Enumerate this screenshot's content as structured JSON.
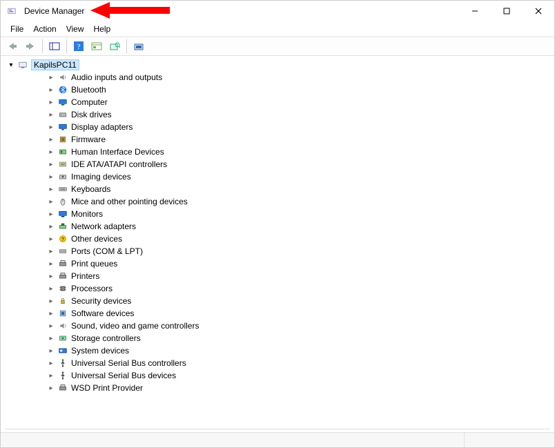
{
  "titlebar": {
    "title": "Device Manager"
  },
  "menus": [
    "File",
    "Action",
    "View",
    "Help"
  ],
  "toolbar_icons": [
    "back-icon",
    "forward-icon",
    "sep",
    "show-hide-tree-icon",
    "sep",
    "help-icon",
    "properties-icon",
    "scan-hardware-icon",
    "sep",
    "add-legacy-icon"
  ],
  "root_node": "KapilsPC11",
  "categories": [
    {
      "icon": "audio-icon",
      "label": "Audio inputs and outputs"
    },
    {
      "icon": "bluetooth-icon",
      "label": "Bluetooth"
    },
    {
      "icon": "computer-icon",
      "label": "Computer"
    },
    {
      "icon": "disk-icon",
      "label": "Disk drives"
    },
    {
      "icon": "display-icon",
      "label": "Display adapters"
    },
    {
      "icon": "firmware-icon",
      "label": "Firmware"
    },
    {
      "icon": "hid-icon",
      "label": "Human Interface Devices"
    },
    {
      "icon": "ide-icon",
      "label": "IDE ATA/ATAPI controllers"
    },
    {
      "icon": "imaging-icon",
      "label": "Imaging devices"
    },
    {
      "icon": "keyboard-icon",
      "label": "Keyboards"
    },
    {
      "icon": "mouse-icon",
      "label": "Mice and other pointing devices"
    },
    {
      "icon": "monitor-icon",
      "label": "Monitors"
    },
    {
      "icon": "network-icon",
      "label": "Network adapters"
    },
    {
      "icon": "other-icon",
      "label": "Other devices"
    },
    {
      "icon": "ports-icon",
      "label": "Ports (COM & LPT)"
    },
    {
      "icon": "printqueue-icon",
      "label": "Print queues"
    },
    {
      "icon": "printer-icon",
      "label": "Printers"
    },
    {
      "icon": "processor-icon",
      "label": "Processors"
    },
    {
      "icon": "security-icon",
      "label": "Security devices"
    },
    {
      "icon": "software-icon",
      "label": "Software devices"
    },
    {
      "icon": "sound-icon",
      "label": "Sound, video and game controllers"
    },
    {
      "icon": "storage-icon",
      "label": "Storage controllers"
    },
    {
      "icon": "system-icon",
      "label": "System devices"
    },
    {
      "icon": "usb-icon",
      "label": "Universal Serial Bus controllers"
    },
    {
      "icon": "usb-icon",
      "label": "Universal Serial Bus devices"
    },
    {
      "icon": "wsd-icon",
      "label": "WSD Print Provider"
    }
  ]
}
